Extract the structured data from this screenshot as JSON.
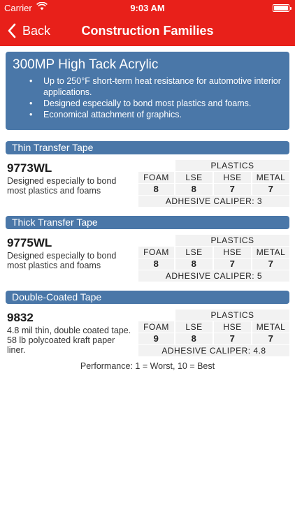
{
  "status_bar": {
    "carrier": "Carrier",
    "time": "9:03 AM"
  },
  "nav": {
    "back_label": "Back",
    "title": "Construction Families"
  },
  "header": {
    "title": "300MP High Tack Acrylic",
    "bullets": [
      "Up to 250°F short-term heat resistance for automotive interior applications.",
      "Designed especially to bond most plastics and foams.",
      "Economical attachment of graphics."
    ]
  },
  "sections": [
    {
      "category": "Thin Transfer Tape",
      "product": "9773WL",
      "description": "Designed especially to bond most plastics and foams",
      "group_label": "PLASTICS",
      "columns": [
        "FOAM",
        "LSE",
        "HSE",
        "METAL"
      ],
      "values": [
        "8",
        "8",
        "7",
        "7"
      ],
      "caliper": "ADHESIVE CALIPER: 3"
    },
    {
      "category": "Thick Transfer Tape",
      "product": "9775WL",
      "description": "Designed especially to bond most plastics and foams",
      "group_label": "PLASTICS",
      "columns": [
        "FOAM",
        "LSE",
        "HSE",
        "METAL"
      ],
      "values": [
        "8",
        "8",
        "7",
        "7"
      ],
      "caliper": "ADHESIVE CALIPER: 5"
    },
    {
      "category": "Double-Coated Tape",
      "product": "9832",
      "description": "4.8 mil thin, double coated tape. 58 lb polycoated kraft paper liner.",
      "group_label": "PLASTICS",
      "columns": [
        "FOAM",
        "LSE",
        "HSE",
        "METAL"
      ],
      "values": [
        "9",
        "8",
        "7",
        "7"
      ],
      "caliper": "ADHESIVE CALIPER: 4.8"
    }
  ],
  "footer": {
    "performance": "Performance: 1 = Worst, 10 = Best"
  },
  "colors": {
    "brand_red": "#e8201a",
    "card_blue": "#4a77a8",
    "cell_gray": "#f2f2f2"
  }
}
